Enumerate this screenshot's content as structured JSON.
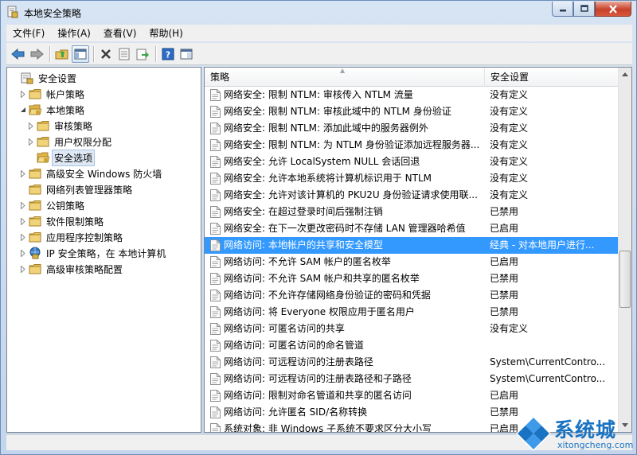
{
  "window": {
    "title": "本地安全策略"
  },
  "menu": [
    "文件(F)",
    "操作(A)",
    "查看(V)",
    "帮助(H)"
  ],
  "toolbar": [
    "back-icon",
    "forward-icon",
    "up-folder-icon",
    "show-tree-icon",
    "delete-icon",
    "properties-icon",
    "export-icon",
    "help-icon",
    "console-icon"
  ],
  "tree": [
    {
      "label": "安全设置",
      "level": 0,
      "expand": "none",
      "icon": "security-settings-icon"
    },
    {
      "label": "帐户策略",
      "level": 1,
      "expand": "collapsed",
      "icon": "folder-icon"
    },
    {
      "label": "本地策略",
      "level": 1,
      "expand": "expanded",
      "icon": "folder-open-icon"
    },
    {
      "label": "审核策略",
      "level": 2,
      "expand": "collapsed",
      "icon": "folder-icon"
    },
    {
      "label": "用户权限分配",
      "level": 2,
      "expand": "collapsed",
      "icon": "folder-icon"
    },
    {
      "label": "安全选项",
      "level": 2,
      "expand": "none",
      "icon": "folder-open-icon",
      "selected": true
    },
    {
      "label": "高级安全 Windows 防火墙",
      "level": 1,
      "expand": "collapsed",
      "icon": "folder-icon"
    },
    {
      "label": "网络列表管理器策略",
      "level": 1,
      "expand": "none",
      "icon": "folder-icon"
    },
    {
      "label": "公钥策略",
      "level": 1,
      "expand": "collapsed",
      "icon": "folder-icon"
    },
    {
      "label": "软件限制策略",
      "level": 1,
      "expand": "collapsed",
      "icon": "folder-icon"
    },
    {
      "label": "应用程序控制策略",
      "level": 1,
      "expand": "collapsed",
      "icon": "folder-icon"
    },
    {
      "label": "IP 安全策略，在 本地计算机",
      "level": 1,
      "expand": "collapsed",
      "icon": "ip-security-icon"
    },
    {
      "label": "高级审核策略配置",
      "level": 1,
      "expand": "collapsed",
      "icon": "folder-icon"
    }
  ],
  "list": {
    "columns": [
      "策略",
      "安全设置"
    ],
    "rows": [
      {
        "name": "网络安全: 限制 NTLM: 审核传入 NTLM 流量",
        "value": "没有定义"
      },
      {
        "name": "网络安全: 限制 NTLM: 审核此域中的 NTLM 身份验证",
        "value": "没有定义"
      },
      {
        "name": "网络安全: 限制 NTLM: 添加此域中的服务器例外",
        "value": "没有定义"
      },
      {
        "name": "网络安全: 限制 NTLM: 为 NTLM 身份验证添加远程服务器...",
        "value": "没有定义"
      },
      {
        "name": "网络安全: 允许 LocalSystem NULL 会话回退",
        "value": "没有定义"
      },
      {
        "name": "网络安全: 允许本地系统将计算机标识用于 NTLM",
        "value": "没有定义"
      },
      {
        "name": "网络安全: 允许对该计算机的 PKU2U 身份验证请求使用联...",
        "value": "没有定义"
      },
      {
        "name": "网络安全: 在超过登录时间后强制注销",
        "value": "已禁用"
      },
      {
        "name": "网络安全: 在下一次更改密码时不存储 LAN 管理器哈希值",
        "value": "已启用"
      },
      {
        "name": "网络访问: 本地帐户的共享和安全模型",
        "value": "经典 - 对本地用户进行...",
        "selected": true
      },
      {
        "name": "网络访问: 不允许 SAM 帐户的匿名枚举",
        "value": "已启用"
      },
      {
        "name": "网络访问: 不允许 SAM 帐户和共享的匿名枚举",
        "value": "已禁用"
      },
      {
        "name": "网络访问: 不允许存储网络身份验证的密码和凭据",
        "value": "已禁用"
      },
      {
        "name": "网络访问: 将 Everyone 权限应用于匿名用户",
        "value": "已禁用"
      },
      {
        "name": "网络访问: 可匿名访问的共享",
        "value": "没有定义"
      },
      {
        "name": "网络访问: 可匿名访问的命名管道",
        "value": ""
      },
      {
        "name": "网络访问: 可远程访问的注册表路径",
        "value": "System\\CurrentContro..."
      },
      {
        "name": "网络访问: 可远程访问的注册表路径和子路径",
        "value": "System\\CurrentContro..."
      },
      {
        "name": "网络访问: 限制对命名管道和共享的匿名访问",
        "value": "已启用"
      },
      {
        "name": "网络访问: 允许匿名 SID/名称转换",
        "value": "已禁用"
      },
      {
        "name": "系统对象: 非 Windows 子系统不要求区分大小写",
        "value": "已启用"
      }
    ]
  },
  "watermark": {
    "brand": "系统城",
    "url": "xitongcheng.com"
  },
  "colors": {
    "selection": "#3399ff",
    "folder": "#e8c15a"
  }
}
